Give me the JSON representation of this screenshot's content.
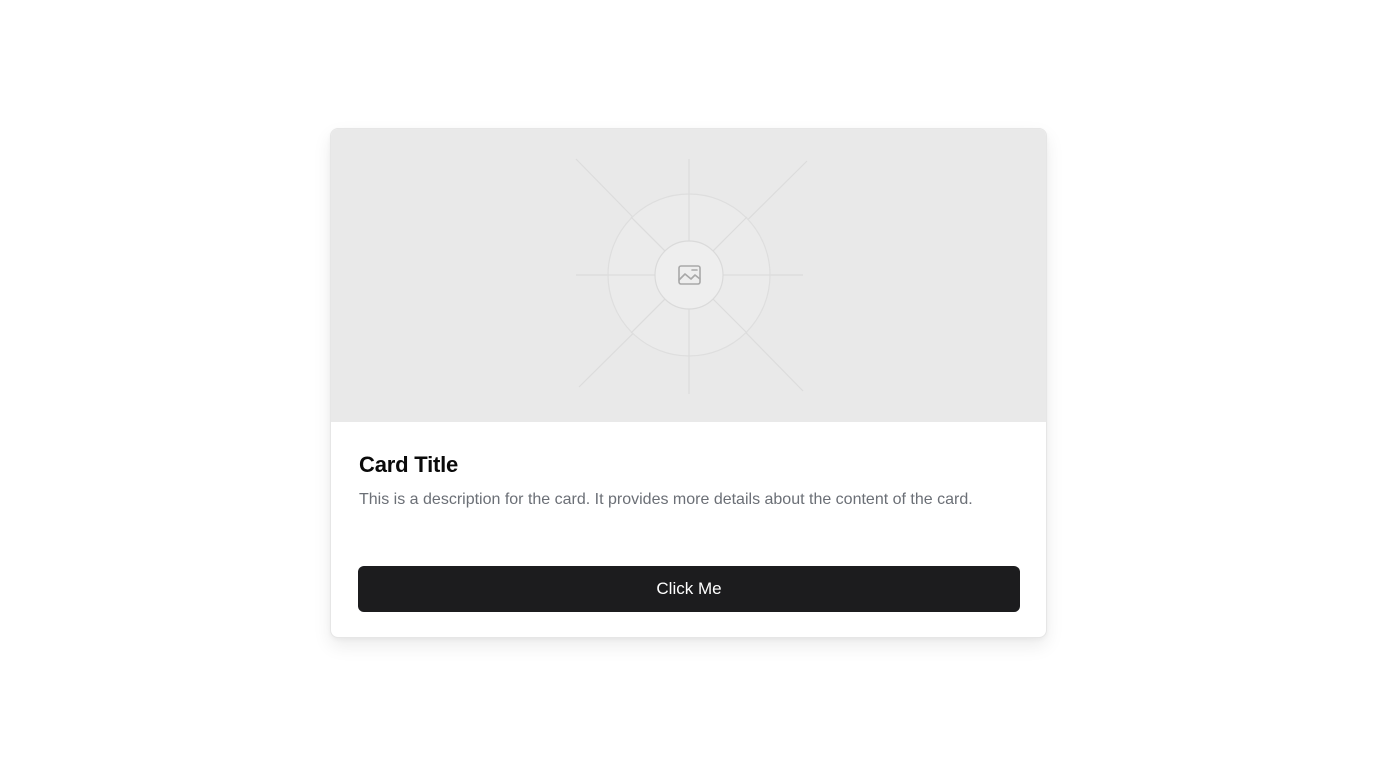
{
  "card": {
    "image_icon": "image-icon",
    "title": "Card Title",
    "description": "This is a description for the card. It provides more details about the content of the card.",
    "button_label": "Click Me"
  },
  "colors": {
    "image_bg": "#e9e9e9",
    "button_bg": "#1c1c1e",
    "description_text": "#6b6f76"
  }
}
